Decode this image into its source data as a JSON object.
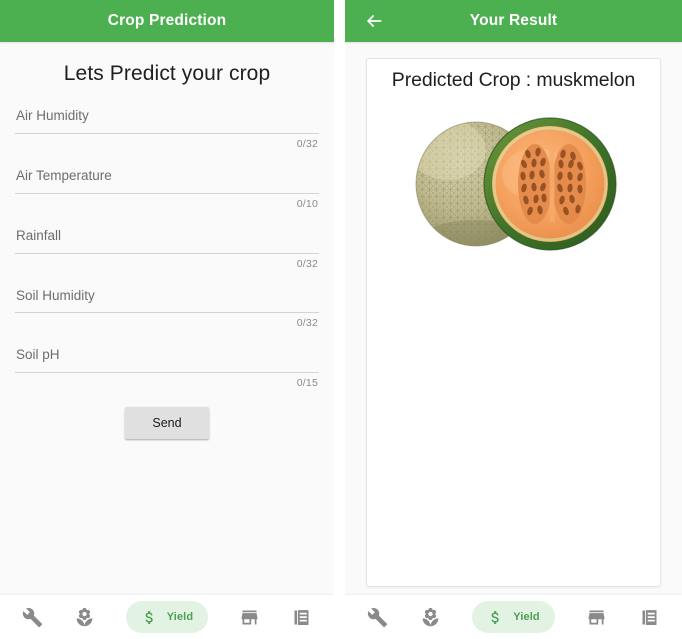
{
  "left_screen": {
    "appbar": {
      "title": "Crop Prediction"
    },
    "heading": "Lets Predict your crop",
    "fields": [
      {
        "label": "Air Humidity",
        "value": "",
        "counter": "0/32"
      },
      {
        "label": "Air Temperature",
        "value": "",
        "counter": "0/10"
      },
      {
        "label": "Rainfall",
        "value": "",
        "counter": "0/32"
      },
      {
        "label": "Soil Humidity",
        "value": "",
        "counter": "0/32"
      },
      {
        "label": "Soil pH",
        "value": "",
        "counter": "0/15"
      }
    ],
    "send_button": "Send"
  },
  "right_screen": {
    "appbar": {
      "title": "Your Result",
      "back_icon": "arrow-left-icon"
    },
    "result": {
      "title": "Predicted Crop : muskmelon",
      "image_alt": "muskmelon-photo"
    }
  },
  "bottom_nav": {
    "items": [
      {
        "icon": "wrench-icon",
        "label": "",
        "active": false
      },
      {
        "icon": "flower-icon",
        "label": "",
        "active": false
      },
      {
        "icon": "dollar-icon",
        "label": "Yield",
        "active": true
      },
      {
        "icon": "store-icon",
        "label": "",
        "active": false
      },
      {
        "icon": "document-icon",
        "label": "",
        "active": false
      }
    ]
  },
  "colors": {
    "appbar_green": "#4caf50",
    "pill_background": "#e2f3e3",
    "pill_text": "#4e9e54",
    "page_background": "#fafafa",
    "icon_gray": "#8a8a8a"
  }
}
